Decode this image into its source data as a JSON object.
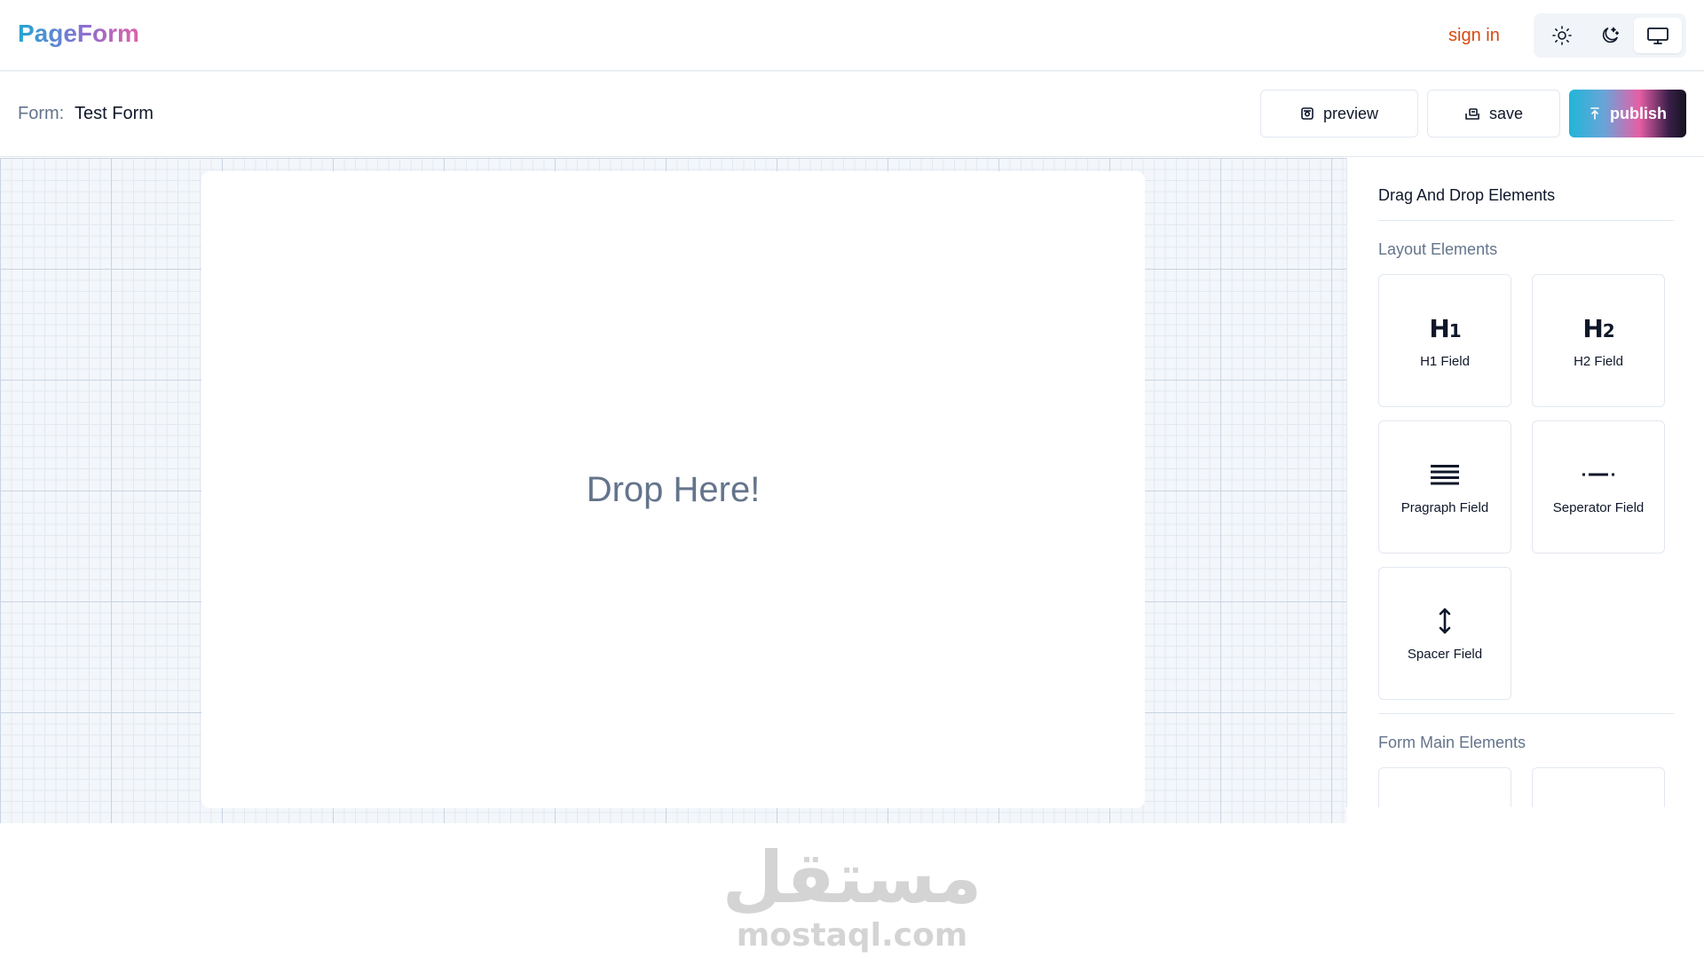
{
  "app": {
    "logo": "PageForm"
  },
  "navbar": {
    "signin_label": "sign in",
    "theme_buttons": [
      {
        "icon": "sun-icon"
      },
      {
        "icon": "moon-icon"
      },
      {
        "icon": "monitor-icon",
        "active": true
      }
    ]
  },
  "formbar": {
    "label": "Form:",
    "name": "Test Form",
    "preview_label": "preview",
    "save_label": "save",
    "publish_label": "publish"
  },
  "canvas": {
    "drop_text": "Drop Here!"
  },
  "sidebar": {
    "title": "Drag And Drop Elements",
    "layout_section": "Layout Elements",
    "layout_items": [
      {
        "icon": "h1-icon",
        "glyph": "H",
        "sub": "1",
        "label": "H1 Field"
      },
      {
        "icon": "h2-icon",
        "glyph": "H",
        "sub": "2",
        "label": "H2 Field"
      },
      {
        "icon": "paragraph-icon",
        "label": "Pragraph Field"
      },
      {
        "icon": "separator-icon",
        "label": "Seperator Field"
      },
      {
        "icon": "vertical-arrows-icon",
        "label": "Spacer Field"
      }
    ],
    "main_section": "Form Main Elements"
  },
  "watermark": {
    "arabic": "مستقل",
    "latin": "mostaql.com"
  },
  "colors": {
    "accent": "#d9480f",
    "brand_start": "#22a6d3",
    "brand_end": "#e060a8"
  }
}
